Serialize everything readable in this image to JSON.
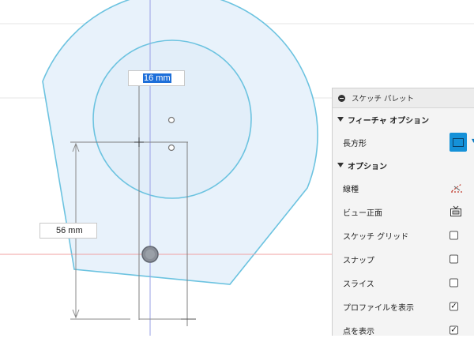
{
  "dimensions": {
    "diameter_value": "16 mm",
    "length_value": "56 mm"
  },
  "palette": {
    "title": "スケッチ パレット",
    "feature_options": {
      "label": "フィーチャ オプション",
      "rectangle_label": "長方形"
    },
    "options": {
      "label": "オプション",
      "items": [
        {
          "label": "線種",
          "control": "linetype-icon"
        },
        {
          "label": "ビュー正面",
          "control": "look-at-icon"
        },
        {
          "label": "スケッチ グリッド",
          "control": "checkbox",
          "checked": false
        },
        {
          "label": "スナップ",
          "control": "checkbox",
          "checked": false
        },
        {
          "label": "スライス",
          "control": "checkbox",
          "checked": false
        },
        {
          "label": "プロファイルを表示",
          "control": "checkbox",
          "checked": true
        },
        {
          "label": "点を表示",
          "control": "checkbox",
          "checked": true
        }
      ]
    }
  },
  "colors": {
    "profile_fill": "#e8f2fb",
    "profile_stroke": "#6cc3e0",
    "axis_red": "#f0a0a0",
    "axis_blue": "#9aa0e6",
    "accent": "#1591d8"
  }
}
